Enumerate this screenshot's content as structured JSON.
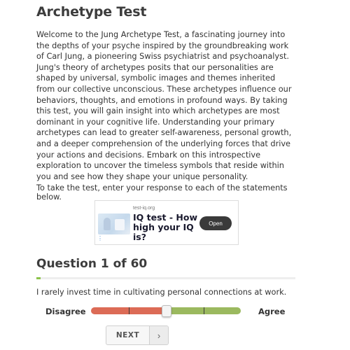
{
  "page": {
    "title": "Archetype Test",
    "intro": "Welcome to the Jung Archetype Test, a fascinating journey into the depths of your psyche inspired by the groundbreaking work of Carl Jung, a pioneering Swiss psychiatrist and psychoanalyst. Jung's theory of archetypes posits that our personalities are shaped by universal, symbolic images and themes inherited from our collective unconscious. These archetypes influence our behaviors, thoughts, and emotions in profound ways. By taking this test, you will gain insight into which archetypes are most dominant in your cognitive life. Understanding your primary archetypes can lead to greater self-awareness, personal growth, and a deeper comprehension of the underlying forces that drive your actions and decisions. Embark on this introspective exploration to uncover the timeless symbols that reside within you and see how they shape your unique personality.",
    "instructions": "To take the test, enter your response to each of the statements below."
  },
  "ad": {
    "source": "test-iq.org",
    "headline": "IQ test - How high your IQ is?",
    "button_label": "Open",
    "info_icon": "ad-info-icon"
  },
  "question": {
    "heading": "Question 1 of 60",
    "current": 1,
    "total": 60,
    "progress_fraction": 0.0167,
    "statement": "I rarely invest time in cultivating personal connections at work.",
    "scale": {
      "left_label": "Disagree",
      "right_label": "Agree",
      "value_fraction": 0.5,
      "left_color": "#dc6b56",
      "right_color": "#9bb95f"
    }
  },
  "navigation": {
    "next_label": "NEXT",
    "next_icon": "chevron-right-icon"
  },
  "colors": {
    "progress": "#8bc34a",
    "text": "#333333",
    "heading": "#3c3c3c"
  }
}
